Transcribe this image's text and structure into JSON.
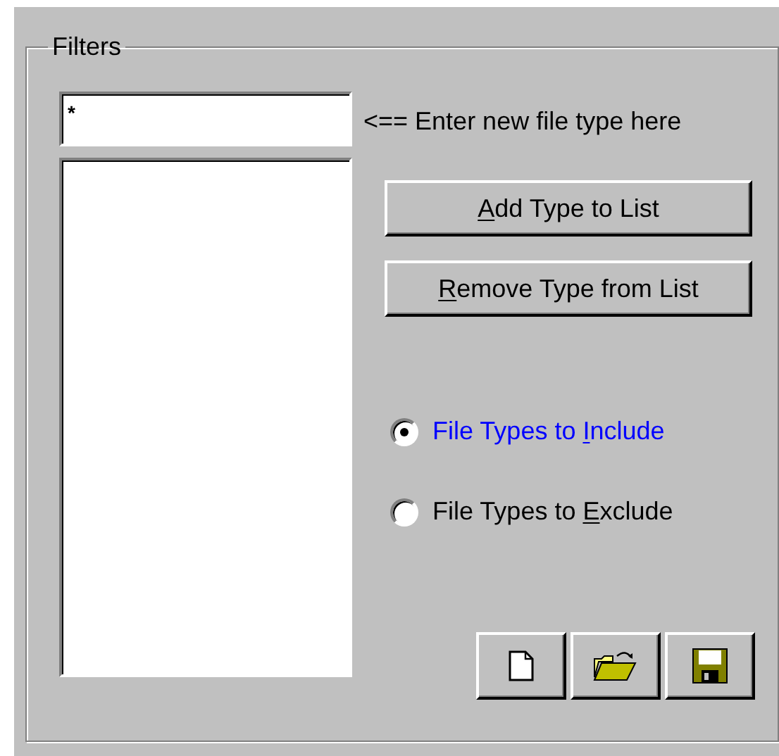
{
  "group": {
    "title": "Filters"
  },
  "file_type_field": {
    "value": "*"
  },
  "hint": "<== Enter new file type here",
  "file_type_list": {
    "kind": "list"
  },
  "buttons": [
    {
      "key": "A",
      "post": "dd Type to List"
    },
    {
      "key": "R",
      "post": "emove Type from List"
    }
  ],
  "radios": [
    {
      "pre": "File Types to ",
      "key": "I",
      "post": "nclude",
      "selected": true
    },
    {
      "pre": "File Types to ",
      "key": "E",
      "post": "xclude",
      "selected": false
    }
  ],
  "toolbar": [
    {
      "kind": "new"
    },
    {
      "kind": "open"
    },
    {
      "kind": "save"
    }
  ]
}
